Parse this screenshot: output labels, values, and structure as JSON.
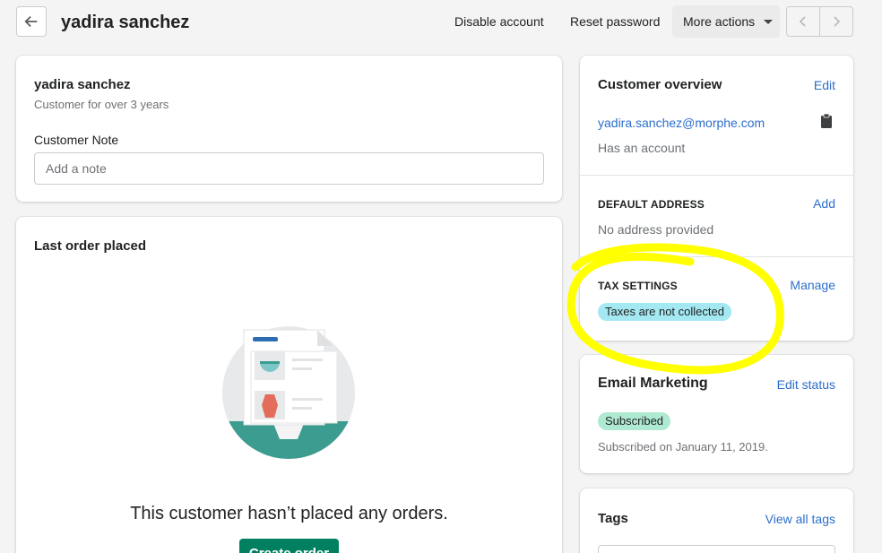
{
  "header": {
    "title": "yadira sanchez",
    "disable_label": "Disable account",
    "reset_label": "Reset password",
    "more_label": "More actions"
  },
  "customer_card": {
    "name": "yadira sanchez",
    "since": "Customer for over 3 years",
    "note_label": "Customer Note",
    "note_placeholder": "Add a note"
  },
  "last_order": {
    "title": "Last order placed",
    "empty_text": "This customer hasn’t placed any orders.",
    "button_label": "Create order"
  },
  "overview": {
    "title": "Customer overview",
    "edit_label": "Edit",
    "email": "yadira.sanchez@morphe.com",
    "account_status": "Has an account",
    "address_title": "DEFAULT ADDRESS",
    "address_action": "Add",
    "address_value": "No address provided",
    "tax_title": "TAX SETTINGS",
    "tax_action": "Manage",
    "tax_badge": "Taxes are not collected"
  },
  "email_marketing": {
    "title": "Email Marketing",
    "action": "Edit status",
    "badge": "Subscribed",
    "date_text": "Subscribed on January 11, 2019."
  },
  "tags": {
    "title": "Tags",
    "action": "View all tags"
  },
  "colors": {
    "link": "#2c6ecb",
    "primary": "#008060",
    "tax_badge": "#a4e8f2",
    "subscribed_badge": "#aee9d1",
    "highlight": "#ffff00"
  }
}
